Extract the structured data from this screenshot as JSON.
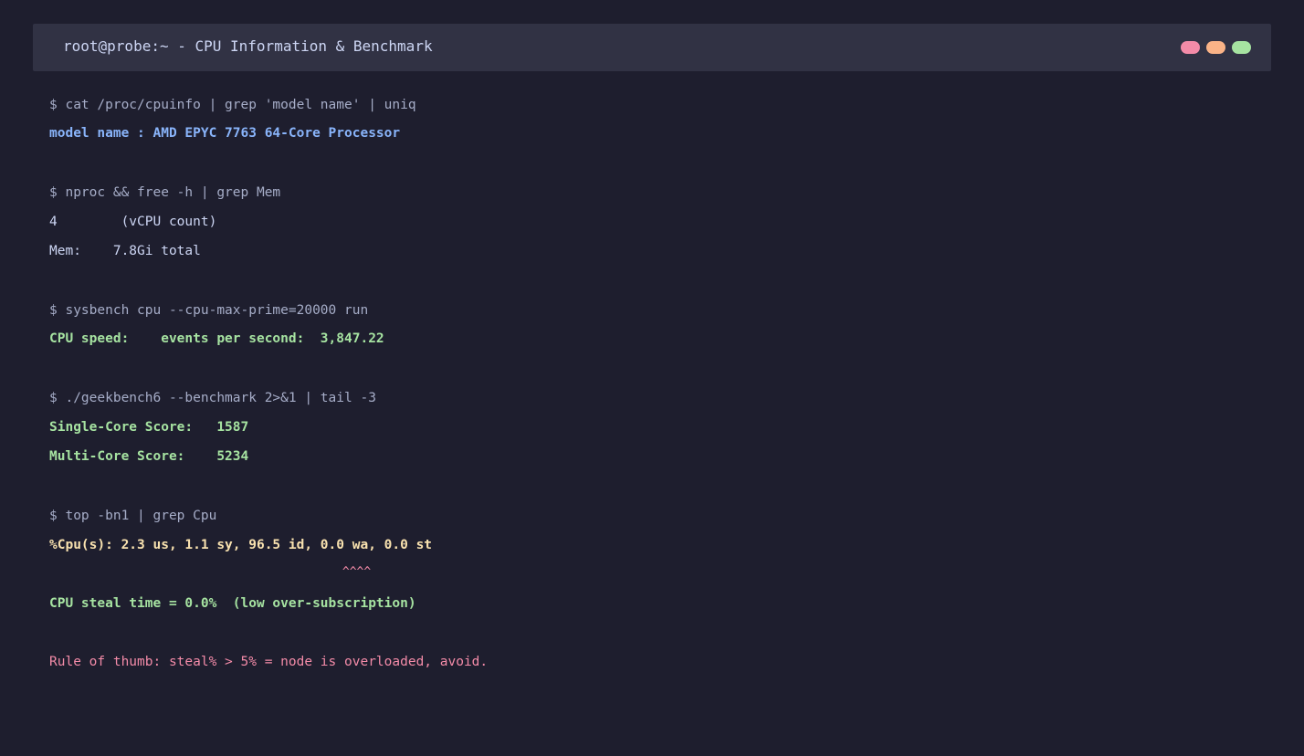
{
  "window": {
    "title": "root@probe:~ - CPU Information & Benchmark",
    "dots": [
      {
        "name": "red",
        "color": "#f38ba8"
      },
      {
        "name": "yellow",
        "color": "#fab387"
      },
      {
        "name": "green",
        "color": "#a6e3a1"
      }
    ]
  },
  "colors": {
    "background": "#1e1e2e",
    "titlebar": "#313244",
    "command": "#a6adc8",
    "text": "#cdd6f4",
    "blue": "#89b4fa",
    "green": "#a6e3a1",
    "yellow": "#f9e2af",
    "pink": "#f38ba8"
  },
  "terminal": {
    "cmd_cpuinfo": "$ cat /proc/cpuinfo | grep 'model name' | uniq",
    "out_model": "model name : AMD EPYC 7763 64-Core Processor",
    "cmd_nproc": "$ nproc && free -h | grep Mem",
    "out_vcpu": "4        (vCPU count)",
    "out_mem": "Mem:    7.8Gi total",
    "cmd_sysbench": "$ sysbench cpu --cpu-max-prime=20000 run",
    "out_cpu_speed": "CPU speed:    events per second:  3,847.22",
    "cmd_geekbench": "$ ./geekbench6 --benchmark 2>&1 | tail -3",
    "out_single": "Single-Core Score:   1587",
    "out_multi": "Multi-Core Score:    5234",
    "cmd_top": "$ top -bn1 | grep Cpu",
    "out_cpu_stats": "%Cpu(s): 2.3 us, 1.1 sy, 96.5 id, 0.0 wa, 0.0 st",
    "out_marker": "                                         ^^^^",
    "out_steal": "CPU steal time = 0.0%  (low over-subscription)",
    "out_rule": "Rule of thumb: steal% > 5% = node is overloaded, avoid."
  }
}
